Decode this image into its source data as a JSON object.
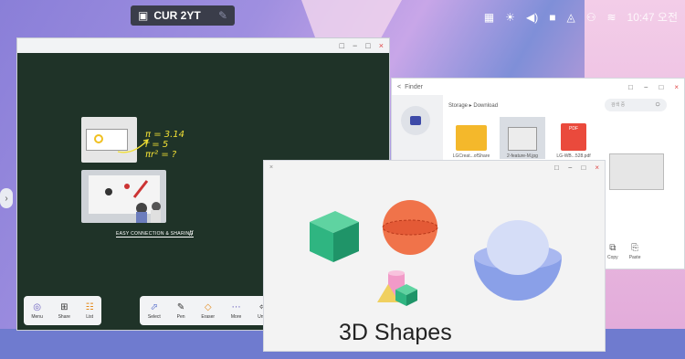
{
  "status": {
    "camera_label": "CUR 2YT",
    "clock": "10:47 오전",
    "icons": [
      "screen-icon",
      "brightness-icon",
      "volume-icon",
      "camera-icon",
      "triangle-icon",
      "network-icon",
      "wifi-icon"
    ]
  },
  "whiteboard": {
    "window_controls": [
      "□",
      "−",
      "□",
      "×"
    ],
    "formula": [
      "π = 3.14",
      "r = 5",
      "πr² = ?"
    ],
    "caption": "EASY CONNECTION & SHARING",
    "toolbar_left": [
      {
        "label": "Menu",
        "icon": "◎"
      },
      {
        "label": "Share",
        "icon": "⊞"
      },
      {
        "label": "List",
        "icon": "☷"
      }
    ],
    "toolbar_right": [
      {
        "label": "Select",
        "icon": "⬀"
      },
      {
        "label": "Pen",
        "icon": "✎"
      },
      {
        "label": "Eraser",
        "icon": "◇"
      },
      {
        "label": "More",
        "icon": "⋯"
      },
      {
        "label": "Undo",
        "icon": "⇦"
      }
    ]
  },
  "finder": {
    "title": "Finder",
    "back": "<",
    "path": "Storage ▸ Download",
    "search_placeholder": "검색 중",
    "files": [
      {
        "name": "LGCreat...ofShare",
        "type": "folder"
      },
      {
        "name": "2-feature-M.jpg",
        "type": "image"
      },
      {
        "name": "LG-WB...528.pdf",
        "type": "pdf"
      }
    ],
    "pdf_badge": "PDF",
    "actions": [
      {
        "label": "Copy",
        "icon": "⧉"
      },
      {
        "label": "Paste",
        "icon": "⎘"
      }
    ]
  },
  "shapes_window": {
    "caption": "3D Shapes",
    "colors": {
      "cube": "#2fb581",
      "sphere": "#f0734a",
      "dome": "#8aa0e8"
    }
  }
}
